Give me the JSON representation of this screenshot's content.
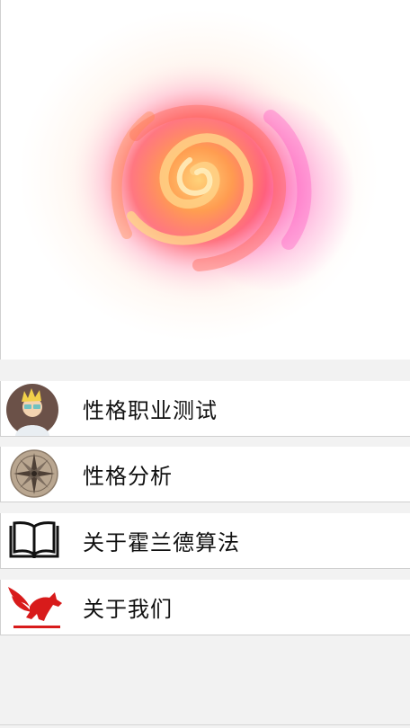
{
  "menu": {
    "items": [
      {
        "label": "性格职业测试",
        "icon": "avatar-icon"
      },
      {
        "label": "性格分析",
        "icon": "compass-icon"
      },
      {
        "label": "关于霍兰德算法",
        "icon": "book-icon"
      },
      {
        "label": "关于我们",
        "icon": "pegasus-logo-icon"
      }
    ]
  },
  "colors": {
    "background": "#f2f2f2",
    "row": "#ffffff",
    "brand_red": "#d81b1b"
  }
}
